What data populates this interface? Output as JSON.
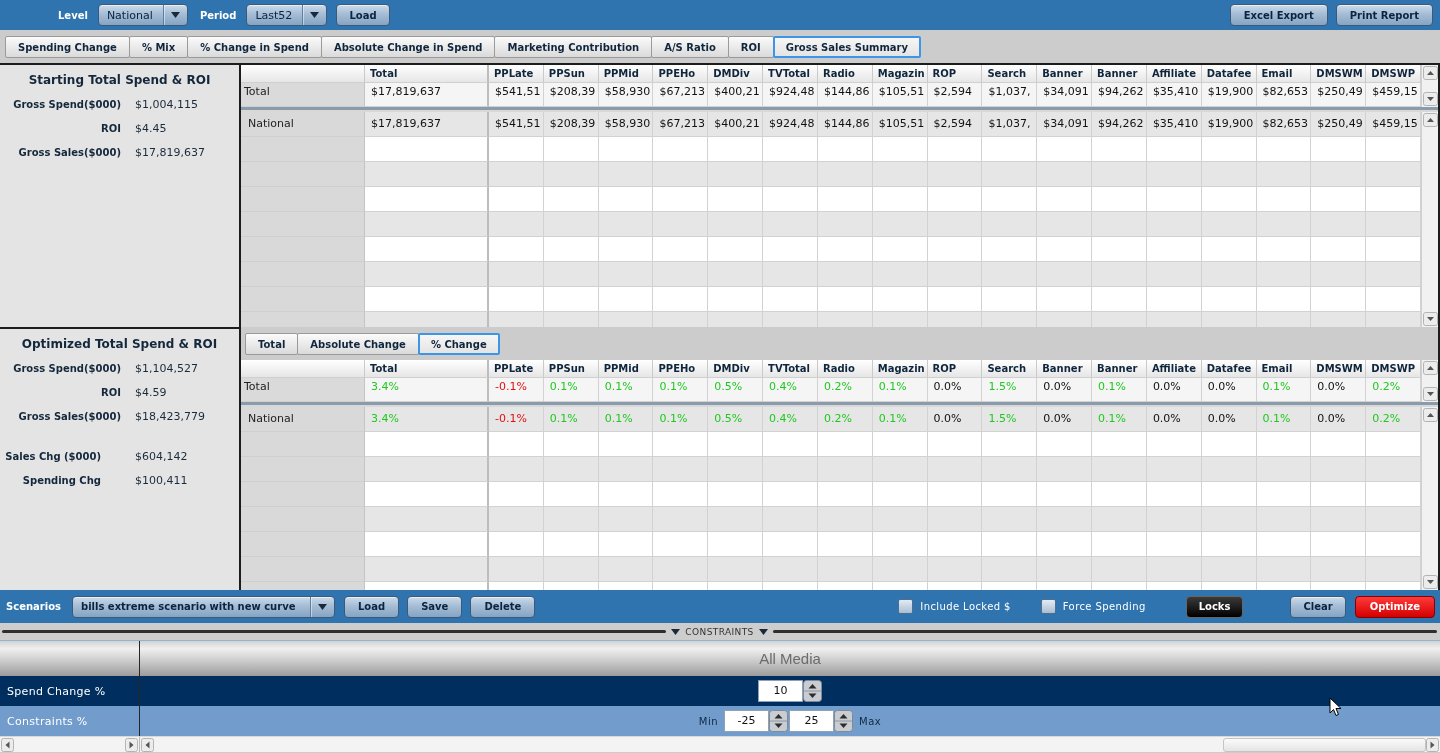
{
  "toolbar": {
    "level_label": "Level",
    "level_value": "National",
    "period_label": "Period",
    "period_value": "Last52",
    "load_button": "Load",
    "report_buttons": [
      "Excel Export",
      "Print Report"
    ]
  },
  "tabs": [
    {
      "label": "Spending Change",
      "selected": false
    },
    {
      "label": "% Mix",
      "selected": false
    },
    {
      "label": "% Change in Spend",
      "selected": false
    },
    {
      "label": "Absolute Change in Spend",
      "selected": false
    },
    {
      "label": "Marketing Contribution",
      "selected": false
    },
    {
      "label": "A/S Ratio",
      "selected": false
    },
    {
      "label": "ROI",
      "selected": false
    },
    {
      "label": "Gross Sales Summary",
      "selected": true
    }
  ],
  "starting_summary": {
    "title": "Starting Total Spend & ROI",
    "metrics": [
      {
        "label": "Gross Spend($000)",
        "value": "$1,004,115"
      },
      {
        "label": "ROI",
        "value": "$4.45"
      },
      {
        "label": "Gross Sales($000)",
        "value": "$17,819,637"
      }
    ]
  },
  "starting_table": {
    "columns": [
      "Total",
      "PPLate",
      "PPSun",
      "PPMid",
      "PPEHo",
      "DMDiv",
      "TVTotal",
      "Radio",
      "Magazin",
      "ROP",
      "Search",
      "Banner",
      "Banner",
      "Affiliate",
      "Datafee",
      "Email",
      "DMSWM",
      "DMSWP"
    ],
    "total_row": {
      "label": "Total",
      "cells": [
        "$17,819,637",
        "$541,51",
        "$208,39",
        "$58,930",
        "$67,213",
        "$400,21",
        "$924,48",
        "$144,86",
        "$105,51",
        "$2,594",
        "$1,037,",
        "$34,091",
        "$94,262",
        "$35,410",
        "$19,900",
        "$82,653",
        "$250,49",
        "$459,15"
      ]
    },
    "rows": [
      {
        "label": "National",
        "cells": [
          "$17,819,637",
          "$541,51",
          "$208,39",
          "$58,930",
          "$67,213",
          "$400,21",
          "$924,48",
          "$144,86",
          "$105,51",
          "$2,594",
          "$1,037,",
          "$34,091",
          "$94,262",
          "$35,410",
          "$19,900",
          "$82,653",
          "$250,49",
          "$459,15"
        ]
      }
    ]
  },
  "optimized_summary": {
    "title": "Optimized Total Spend & ROI",
    "metrics": [
      {
        "label": "Gross Spend($000)",
        "value": "$1,104,527"
      },
      {
        "label": "ROI",
        "value": "$4.59"
      },
      {
        "label": "Gross Sales($000)",
        "value": "$18,423,779"
      }
    ],
    "change_metrics": [
      {
        "label": "Sales Chg ($000)",
        "value": "$604,142"
      },
      {
        "label": "Spending Chg",
        "value": "$100,411"
      }
    ]
  },
  "view_tabs": [
    {
      "label": "Total",
      "selected": false
    },
    {
      "label": "Absolute Change",
      "selected": false
    },
    {
      "label": "% Change",
      "selected": true
    }
  ],
  "optimized_table": {
    "columns": [
      "Total",
      "PPLate",
      "PPSun",
      "PPMid",
      "PPEHo",
      "DMDiv",
      "TVTotal",
      "Radio",
      "Magazin",
      "ROP",
      "Search",
      "Banner",
      "Banner",
      "Affiliate",
      "Datafee",
      "Email",
      "DMSWM",
      "DMSWP"
    ],
    "total_row": {
      "label": "Total",
      "cells": [
        {
          "value": "3.4%",
          "color": "#20c820"
        },
        {
          "value": "-0.1%",
          "color": "#e01010"
        },
        {
          "value": "0.1%",
          "color": "#20c820"
        },
        {
          "value": "0.1%",
          "color": "#20c820"
        },
        {
          "value": "0.1%",
          "color": "#20c820"
        },
        {
          "value": "0.5%",
          "color": "#20c820"
        },
        {
          "value": "0.4%",
          "color": "#20c820"
        },
        {
          "value": "0.2%",
          "color": "#20c820"
        },
        {
          "value": "0.1%",
          "color": "#20c820"
        },
        {
          "value": "0.0%"
        },
        {
          "value": "1.5%",
          "color": "#20c820"
        },
        {
          "value": "0.0%"
        },
        {
          "value": "0.1%",
          "color": "#20c820"
        },
        {
          "value": "0.0%"
        },
        {
          "value": "0.0%"
        },
        {
          "value": "0.1%",
          "color": "#20c820"
        },
        {
          "value": "0.0%"
        },
        {
          "value": "0.2%",
          "color": "#20c820"
        }
      ]
    },
    "rows": [
      {
        "label": "National",
        "cells": [
          {
            "value": "3.4%",
            "color": "#20c820"
          },
          {
            "value": "-0.1%",
            "color": "#e01010"
          },
          {
            "value": "0.1%",
            "color": "#20c820"
          },
          {
            "value": "0.1%",
            "color": "#20c820"
          },
          {
            "value": "0.1%",
            "color": "#20c820"
          },
          {
            "value": "0.5%",
            "color": "#20c820"
          },
          {
            "value": "0.4%",
            "color": "#20c820"
          },
          {
            "value": "0.2%",
            "color": "#20c820"
          },
          {
            "value": "0.1%",
            "color": "#20c820"
          },
          {
            "value": "0.0%"
          },
          {
            "value": "1.5%",
            "color": "#20c820"
          },
          {
            "value": "0.0%"
          },
          {
            "value": "0.1%",
            "color": "#20c820"
          },
          {
            "value": "0.0%"
          },
          {
            "value": "0.0%"
          },
          {
            "value": "0.1%",
            "color": "#20c820"
          },
          {
            "value": "0.0%"
          },
          {
            "value": "0.2%",
            "color": "#20c820"
          }
        ]
      }
    ]
  },
  "scenario_bar": {
    "label": "Scenarios",
    "scenario": "bills extreme scenario with new curve",
    "buttons": [
      "Load",
      "Save",
      "Delete"
    ],
    "options": [
      {
        "label": "Include Locked $",
        "checked": false
      },
      {
        "label": "Force Spending",
        "checked": false
      }
    ],
    "actions": [
      {
        "label": "Locks",
        "kind": "dark"
      },
      {
        "label": "Clear",
        "kind": "normal"
      },
      {
        "label": "Optimize",
        "kind": "primary"
      }
    ]
  },
  "constraints": {
    "title": "CONSTRAINTS",
    "column": "All Media",
    "rows": [
      {
        "label": "Spend Change %",
        "kind": "single",
        "selected": true,
        "value": "10"
      },
      {
        "label": "Constraints %",
        "kind": "range",
        "selected": false,
        "min_label": "Min",
        "min": "-25",
        "max": "25",
        "max_label": "Max"
      }
    ]
  }
}
